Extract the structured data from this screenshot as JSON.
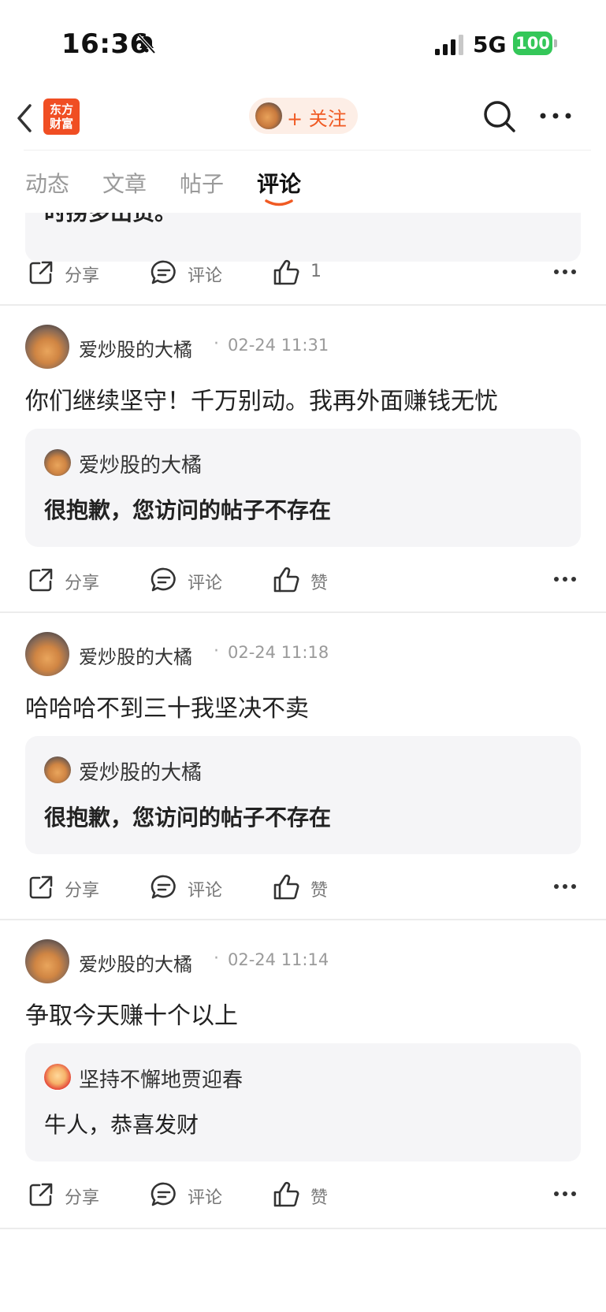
{
  "status_bar": {
    "time": "16:36",
    "network": "5G",
    "battery": "100",
    "battery_color": "#34c759"
  },
  "nav": {
    "logo_line1": "东方",
    "logo_line2": "财富",
    "follow_label": "+ 关注",
    "accent_color": "#f05a23"
  },
  "tabs": [
    {
      "label": "动态"
    },
    {
      "label": "文章"
    },
    {
      "label": "帖子"
    },
    {
      "label": "评论",
      "active": true
    }
  ],
  "partial_top": {
    "quote_text": "时捞多出货。",
    "share": "分享",
    "comment": "评论",
    "like_count": "1"
  },
  "posts": [
    {
      "author": "爱炒股的大橘",
      "dot": "·",
      "time": "02-24 11:31",
      "text": "你们继续坚守！千万别动。我再外面赚钱无忧",
      "quote_author": "爱炒股的大橘",
      "quote_text": "很抱歉，您访问的帖子不存在",
      "share": "分享",
      "comment": "评论",
      "like": "赞"
    },
    {
      "author": "爱炒股的大橘",
      "dot": "·",
      "time": "02-24 11:18",
      "text": "哈哈哈不到三十我坚决不卖",
      "quote_author": "爱炒股的大橘",
      "quote_text": "很抱歉，您访问的帖子不存在",
      "share": "分享",
      "comment": "评论",
      "like": "赞"
    },
    {
      "author": "爱炒股的大橘",
      "dot": "·",
      "time": "02-24 11:14",
      "text": "争取今天赚十个以上",
      "quote_author": "坚持不懈地贾迎春",
      "quote_text": "牛人，恭喜发财",
      "share": "分享",
      "comment": "评论",
      "like": "赞"
    }
  ]
}
